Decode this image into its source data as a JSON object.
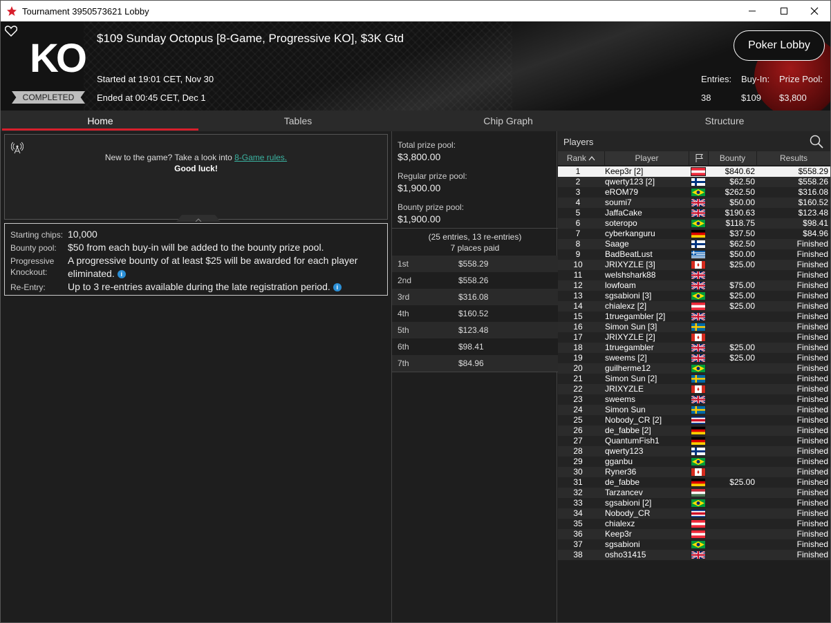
{
  "window": {
    "title": "Tournament 3950573621 Lobby"
  },
  "header": {
    "logo": "KO",
    "status": "COMPLETED",
    "title": "$109 Sunday Octopus [8-Game, Progressive KO], $3K Gtd",
    "started": "Started at 19:01 CET, Nov 30",
    "ended": "Ended at 00:45 CET, Dec 1",
    "poker_lobby": "Poker Lobby",
    "entries_label": "Entries:",
    "entries": "38",
    "buyin_label": "Buy-In:",
    "buyin": "$109",
    "prizepool_label": "Prize Pool:",
    "prizepool": "$3,800"
  },
  "tabs": [
    "Home",
    "Tables",
    "Chip Graph",
    "Structure"
  ],
  "home": {
    "new_text": "New to the game? Take a look into ",
    "rules_link": "8-Game rules.",
    "good_luck": "Good luck!",
    "info": [
      {
        "label": "Starting chips:",
        "value": "10,000"
      },
      {
        "label": "Bounty pool:",
        "value": "$50 from each buy-in will be added to the bounty prize pool."
      },
      {
        "label": "Progressive Knockout:",
        "value": "A progressive bounty of at least $25 will be awarded for each player eliminated."
      },
      {
        "label": "Re-Entry:",
        "value": "Up to 3 re-entries available during the late registration period."
      }
    ]
  },
  "prizes": {
    "total_label": "Total prize pool:",
    "total": "$3,800.00",
    "regular_label": "Regular prize pool:",
    "regular": "$1,900.00",
    "bounty_label": "Bounty prize pool:",
    "bounty": "$1,900.00",
    "entries_note": "(25 entries, 13 re-entries)",
    "places_paid": "7 places paid",
    "payouts": [
      {
        "place": "1st",
        "amount": "$558.29"
      },
      {
        "place": "2nd",
        "amount": "$558.26"
      },
      {
        "place": "3rd",
        "amount": "$316.08"
      },
      {
        "place": "4th",
        "amount": "$160.52"
      },
      {
        "place": "5th",
        "amount": "$123.48"
      },
      {
        "place": "6th",
        "amount": "$98.41"
      },
      {
        "place": "7th",
        "amount": "$84.96"
      }
    ]
  },
  "players": {
    "title": "Players",
    "columns": {
      "rank": "Rank",
      "player": "Player",
      "bounty": "Bounty",
      "results": "Results"
    },
    "rows": [
      {
        "rank": "1",
        "name": "Keep3r [2]",
        "flag": "AT",
        "bounty": "$840.62",
        "result": "$558.29"
      },
      {
        "rank": "2",
        "name": "qwerty123 [2]",
        "flag": "FI",
        "bounty": "$62.50",
        "result": "$558.26"
      },
      {
        "rank": "3",
        "name": "eROM79",
        "flag": "BR",
        "bounty": "$262.50",
        "result": "$316.08"
      },
      {
        "rank": "4",
        "name": "soumi7",
        "flag": "GB",
        "bounty": "$50.00",
        "result": "$160.52"
      },
      {
        "rank": "5",
        "name": "JaffaCake",
        "flag": "GB",
        "bounty": "$190.63",
        "result": "$123.48"
      },
      {
        "rank": "6",
        "name": "soteropo",
        "flag": "BR",
        "bounty": "$118.75",
        "result": "$98.41"
      },
      {
        "rank": "7",
        "name": "cyberkanguru",
        "flag": "DE",
        "bounty": "$37.50",
        "result": "$84.96"
      },
      {
        "rank": "8",
        "name": "Saage",
        "flag": "FI",
        "bounty": "$62.50",
        "result": "Finished"
      },
      {
        "rank": "9",
        "name": "BadBeatLust",
        "flag": "GR",
        "bounty": "$50.00",
        "result": "Finished"
      },
      {
        "rank": "10",
        "name": "JRIXYZLE [3]",
        "flag": "CA",
        "bounty": "$25.00",
        "result": "Finished"
      },
      {
        "rank": "11",
        "name": "welshshark88",
        "flag": "GB",
        "bounty": "",
        "result": "Finished"
      },
      {
        "rank": "12",
        "name": "lowfoam",
        "flag": "GB",
        "bounty": "$75.00",
        "result": "Finished"
      },
      {
        "rank": "13",
        "name": "sgsabioni [3]",
        "flag": "BR",
        "bounty": "$25.00",
        "result": "Finished"
      },
      {
        "rank": "14",
        "name": "chialexz [2]",
        "flag": "AT",
        "bounty": "$25.00",
        "result": "Finished"
      },
      {
        "rank": "15",
        "name": "1truegambler [2]",
        "flag": "GB",
        "bounty": "",
        "result": "Finished"
      },
      {
        "rank": "16",
        "name": "Simon Sun [3]",
        "flag": "SE",
        "bounty": "",
        "result": "Finished"
      },
      {
        "rank": "17",
        "name": "JRIXYZLE [2]",
        "flag": "CA",
        "bounty": "",
        "result": "Finished"
      },
      {
        "rank": "18",
        "name": "1truegambler",
        "flag": "GB",
        "bounty": "$25.00",
        "result": "Finished"
      },
      {
        "rank": "19",
        "name": "sweems [2]",
        "flag": "GB",
        "bounty": "$25.00",
        "result": "Finished"
      },
      {
        "rank": "20",
        "name": "guilherme12",
        "flag": "BR",
        "bounty": "",
        "result": "Finished"
      },
      {
        "rank": "21",
        "name": "Simon Sun [2]",
        "flag": "SE",
        "bounty": "",
        "result": "Finished"
      },
      {
        "rank": "22",
        "name": "JRIXYZLE",
        "flag": "CA",
        "bounty": "",
        "result": "Finished"
      },
      {
        "rank": "23",
        "name": "sweems",
        "flag": "GB",
        "bounty": "",
        "result": "Finished"
      },
      {
        "rank": "24",
        "name": "Simon Sun",
        "flag": "SE",
        "bounty": "",
        "result": "Finished"
      },
      {
        "rank": "25",
        "name": "Nobody_CR [2]",
        "flag": "CR",
        "bounty": "",
        "result": "Finished"
      },
      {
        "rank": "26",
        "name": "de_fabbe [2]",
        "flag": "DE",
        "bounty": "",
        "result": "Finished"
      },
      {
        "rank": "27",
        "name": "QuantumFish1",
        "flag": "DE",
        "bounty": "",
        "result": "Finished"
      },
      {
        "rank": "28",
        "name": "qwerty123",
        "flag": "FI",
        "bounty": "",
        "result": "Finished"
      },
      {
        "rank": "29",
        "name": "gganbu",
        "flag": "BR",
        "bounty": "",
        "result": "Finished"
      },
      {
        "rank": "30",
        "name": "Ryner36",
        "flag": "CA",
        "bounty": "",
        "result": "Finished"
      },
      {
        "rank": "31",
        "name": "de_fabbe",
        "flag": "DE",
        "bounty": "$25.00",
        "result": "Finished"
      },
      {
        "rank": "32",
        "name": "Tarzancev",
        "flag": "HU",
        "bounty": "",
        "result": "Finished"
      },
      {
        "rank": "33",
        "name": "sgsabioni [2]",
        "flag": "BR",
        "bounty": "",
        "result": "Finished"
      },
      {
        "rank": "34",
        "name": "Nobody_CR",
        "flag": "CR",
        "bounty": "",
        "result": "Finished"
      },
      {
        "rank": "35",
        "name": "chialexz",
        "flag": "AT",
        "bounty": "",
        "result": "Finished"
      },
      {
        "rank": "36",
        "name": "Keep3r",
        "flag": "AT",
        "bounty": "",
        "result": "Finished"
      },
      {
        "rank": "37",
        "name": "sgsabioni",
        "flag": "BR",
        "bounty": "",
        "result": "Finished"
      },
      {
        "rank": "38",
        "name": "osho31415",
        "flag": "GB",
        "bounty": "",
        "result": "Finished"
      }
    ]
  },
  "colors": {
    "accent": "#d81f2c",
    "link": "#3bb4a2",
    "info": "#2b8fd6"
  }
}
